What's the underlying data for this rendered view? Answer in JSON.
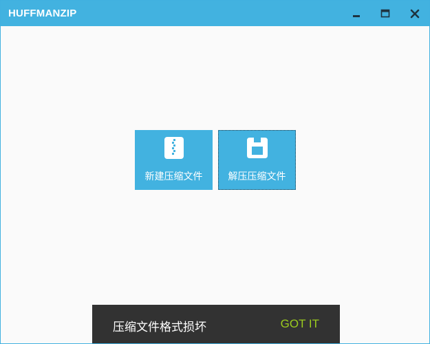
{
  "window": {
    "title": "HUFFMANZIP",
    "controls": {
      "minimize_icon": "minimize-icon",
      "maximize_icon": "maximize-icon",
      "close_icon": "close-icon"
    }
  },
  "main": {
    "tiles": [
      {
        "label": "新建压缩文件",
        "icon": "zip-file-icon"
      },
      {
        "label": "解压压缩文件",
        "icon": "floppy-disk-icon"
      }
    ]
  },
  "snackbar": {
    "message": "压缩文件格式损坏",
    "action": "GOT IT"
  },
  "colors": {
    "accent": "#42b2e0",
    "snackbar_bg": "#323232",
    "snackbar_action": "#9ccc1e",
    "window_bg": "#fafafa"
  }
}
